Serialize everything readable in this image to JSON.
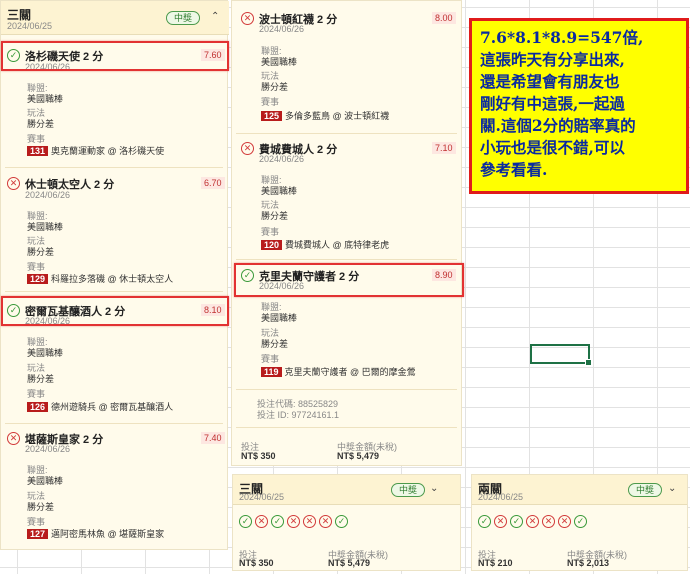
{
  "ticket_main": {
    "title": "三關",
    "date": "2024/06/25",
    "status": "中獎",
    "collapse_icon": "chevron-up-icon"
  },
  "legs": [
    {
      "result": "win",
      "team": "洛杉磯天使 2 分",
      "date": "2024/06/26",
      "odds": "7.60",
      "league_label": "聯盟:",
      "league": "美國職棒",
      "play_label": "玩法",
      "play": "勝分差",
      "event_label": "賽事",
      "game_no": "131",
      "matchup": "奧克蘭運動家 @ 洛杉磯天使"
    },
    {
      "result": "lose",
      "team": "休士頓太空人 2 分",
      "date": "2024/06/26",
      "odds": "6.70",
      "league_label": "聯盟:",
      "league": "美國職棒",
      "play_label": "玩法",
      "play": "勝分差",
      "event_label": "賽事",
      "game_no": "129",
      "matchup": "科羅拉多落磯 @ 休士頓太空人"
    },
    {
      "result": "win",
      "team": "密爾瓦基釀酒人 2 分",
      "date": "2024/06/26",
      "odds": "8.10",
      "league_label": "聯盟:",
      "league": "美國職棒",
      "play_label": "玩法",
      "play": "勝分差",
      "event_label": "賽事",
      "game_no": "126",
      "matchup": "德州遊騎兵 @ 密爾瓦基釀酒人"
    },
    {
      "result": "lose",
      "team": "堪薩斯皇家 2 分",
      "date": "2024/06/26",
      "odds": "7.40",
      "league_label": "聯盟:",
      "league": "美國職棒",
      "play_label": "玩法",
      "play": "勝分差",
      "event_label": "賽事",
      "game_no": "127",
      "matchup": "邁阿密馬林魚 @ 堪薩斯皇家"
    },
    {
      "result": "lose",
      "team": "波士頓紅襪 2 分",
      "date": "2024/06/26",
      "odds": "8.00",
      "league_label": "聯盟:",
      "league": "美國職棒",
      "play_label": "玩法",
      "play": "勝分差",
      "event_label": "賽事",
      "game_no": "125",
      "matchup": "多倫多藍鳥 @ 波士頓紅襪"
    },
    {
      "result": "lose",
      "team": "費城費城人 2 分",
      "date": "2024/06/26",
      "odds": "7.10",
      "league_label": "聯盟:",
      "league": "美國職棒",
      "play_label": "玩法",
      "play": "勝分差",
      "event_label": "賽事",
      "game_no": "120",
      "matchup": "費城費城人 @ 底特律老虎"
    },
    {
      "result": "win",
      "team": "克里夫蘭守護者 2 分",
      "date": "2024/06/26",
      "odds": "8.90",
      "league_label": "聯盟:",
      "league": "美國職棒",
      "play_label": "玩法",
      "play": "勝分差",
      "event_label": "賽事",
      "game_no": "119",
      "matchup": "克里夫蘭守護者 @ 巴爾的摩金鶯"
    }
  ],
  "ticket_info": {
    "code": "投注代碼: 88525829",
    "id": "投注 ID: 97724161.1",
    "stake_label": "投注",
    "stake": "NT$ 350",
    "payout_label": "中獎金額(未稅)",
    "payout": "NT$ 5,479"
  },
  "summary_cards": [
    {
      "title": "三關",
      "date": "2024/06/25",
      "status": "中獎",
      "results": [
        "win",
        "lose",
        "win",
        "lose",
        "lose",
        "lose",
        "win"
      ],
      "stake_label": "投注",
      "stake": "NT$ 350",
      "payout_label": "中獎金額(未稅)",
      "payout": "NT$ 5,479",
      "expand_icon": "chevron-down-icon"
    },
    {
      "title": "兩關",
      "date": "2024/06/25",
      "status": "中獎",
      "results": [
        "win",
        "lose",
        "win",
        "lose",
        "lose",
        "lose",
        "win"
      ],
      "stake_label": "投注",
      "stake": "NT$ 210",
      "payout_label": "中獎金額(未稅)",
      "payout": "NT$ 2,013",
      "expand_icon": "chevron-down-icon"
    }
  ],
  "note": {
    "line1": "7.6*8.1*8.9=547倍,",
    "line2": "這張昨天有分享出來,",
    "line3": "還是希望會有朋友也",
    "line4": "剛好有中這張,一起過",
    "line5": "關.這個2分的賠率真的",
    "line6": "小玩也是很不錯,可以",
    "line7": "參考看看."
  },
  "colors": {
    "win": "#3a9a3a",
    "lose": "#d23a3a",
    "odds": "#c03030",
    "highlight": "#e23232",
    "note_bg": "#ffff00",
    "note_text": "#0a2aa0"
  }
}
